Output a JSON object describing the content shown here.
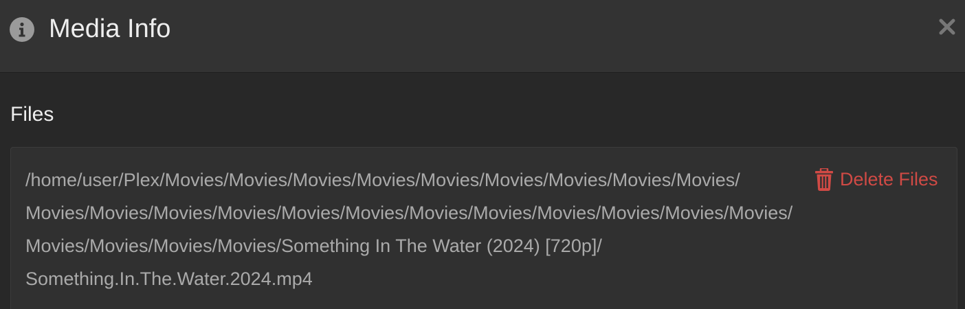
{
  "header": {
    "title": "Media Info",
    "icon": "info-icon",
    "close_icon": "close-icon"
  },
  "files_section": {
    "title": "Files",
    "path_lines": [
      "/home/user/Plex/Movies/Movies/Movies/Movies/Movies/Movies/Movies/Movies/Movies/",
      "Movies/Movies/Movies/Movies/Movies/Movies/Movies/Movies/Movies/Movies/Movies/Movies/",
      "Movies/Movies/Movies/Movies/Something In The Water (2024) [720p]/",
      "Something.In.The.Water.2024.mp4"
    ],
    "delete_label": "Delete Files",
    "delete_icon": "trash-icon",
    "delete_color": "#d04a45"
  }
}
